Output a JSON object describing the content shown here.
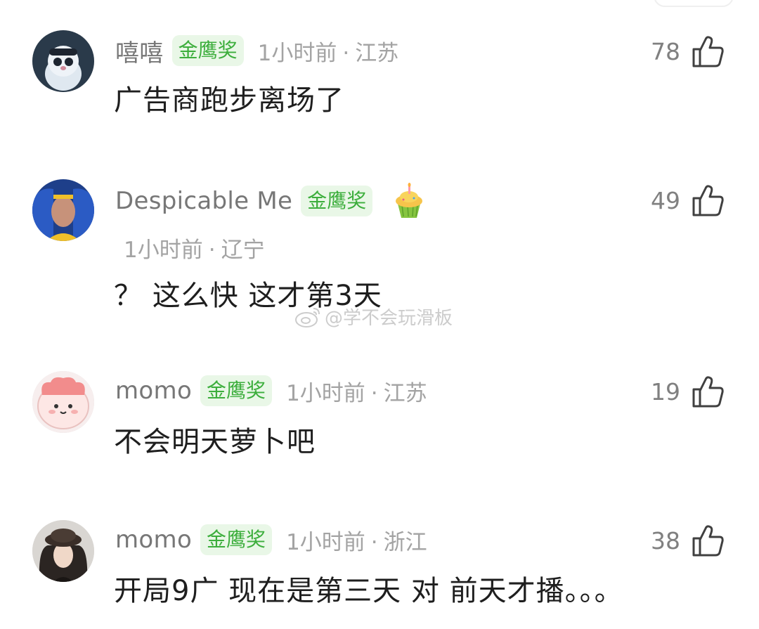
{
  "watermark": "@学不会玩滑板",
  "comments": [
    {
      "username": "嘻嘻",
      "badge": "金鹰奖",
      "time": "1小时前",
      "location": "江苏",
      "text": "广告商跑步离场了",
      "likes": "78"
    },
    {
      "username": "Despicable Me",
      "badge": "金鹰奖",
      "time": "1小时前",
      "location": "辽宁",
      "text": "？ 这么快 这才第3天",
      "likes": "49"
    },
    {
      "username": "momo",
      "badge": "金鹰奖",
      "time": "1小时前",
      "location": "江苏",
      "text": "不会明天萝卜吧",
      "likes": "19"
    },
    {
      "username": "momo",
      "badge": "金鹰奖",
      "time": "1小时前",
      "location": "浙江",
      "text": "开局9广 现在是第三天 对 前天才播。。。",
      "likes": "38"
    }
  ],
  "separator": "·",
  "icons": {
    "like": "thumbs-up-icon",
    "decoration": "cupcake-icon",
    "watermark": "weibo-icon"
  }
}
